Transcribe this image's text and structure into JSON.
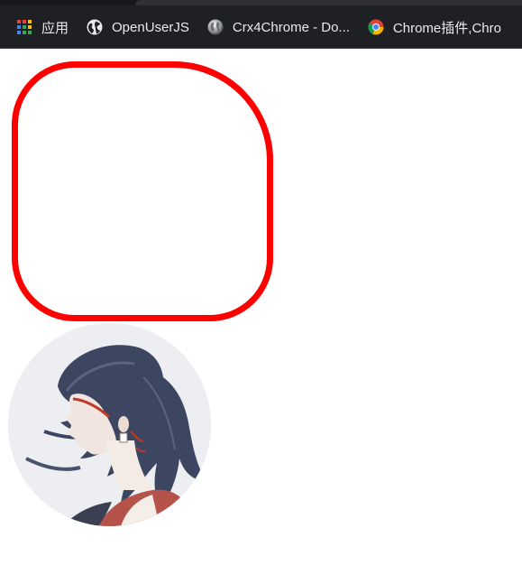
{
  "bookmarks_bar": {
    "items": [
      {
        "label": "应用",
        "icon": "apps-grid-icon"
      },
      {
        "label": "OpenUserJS",
        "icon": "globe-icon"
      },
      {
        "label": "Crx4Chrome - Do...",
        "icon": "crx4chrome-globe-icon"
      },
      {
        "label": "Chrome插件,Chro",
        "icon": "chrome-logo-icon"
      }
    ]
  },
  "colors": {
    "toolbar_bg": "#1f2023",
    "box_border": "#ff0000",
    "page_bg": "#ffffff",
    "avatar_bg": "#eceef1"
  }
}
